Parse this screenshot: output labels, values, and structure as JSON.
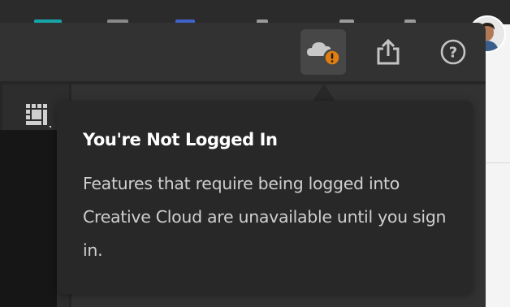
{
  "toolbar": {
    "cloud_button": {
      "icon": "cloud-alert-icon",
      "state": "active",
      "alert_color": "#e07e0f"
    },
    "share_button": {
      "icon": "share-icon"
    },
    "help_button": {
      "icon": "help-icon",
      "glyph": "?"
    }
  },
  "sidebar": {
    "tool_icon": "pixel-grid-icon"
  },
  "tooltip": {
    "title": "You're Not Logged In",
    "message": "Features that require being logged into Creative Cloud are unavailable until you sign in."
  },
  "colors": {
    "panel_bg": "#323232",
    "tooltip_bg": "#282828",
    "alert_orange": "#e07e0f",
    "icon_gray": "#c4c4c4"
  }
}
